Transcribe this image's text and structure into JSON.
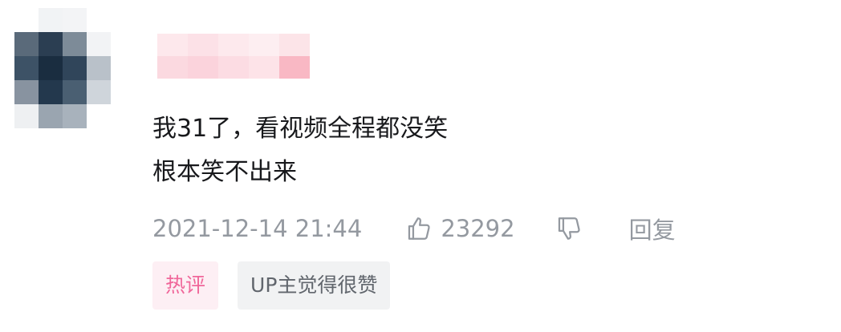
{
  "comment": {
    "avatar_alt": "blurred user avatar",
    "username_redacted": true,
    "text_lines": [
      "我31了，看视频全程都没笑",
      "根本笑不出来"
    ],
    "timestamp": "2021-12-14 21:44",
    "like_count": "23292",
    "reply_label": "回复",
    "tags": {
      "hot": "热评",
      "up_liked": "UP主觉得很赞"
    }
  },
  "icons": {
    "like": "thumbs-up-icon",
    "dislike": "thumbs-down-icon"
  },
  "colors": {
    "text_primary": "#18191c",
    "text_secondary": "#9499a0",
    "hot_tag_bg": "#fdeff4",
    "hot_tag_text": "#f0679a",
    "up_tag_bg": "#f1f2f3",
    "up_tag_text": "#61666d"
  }
}
